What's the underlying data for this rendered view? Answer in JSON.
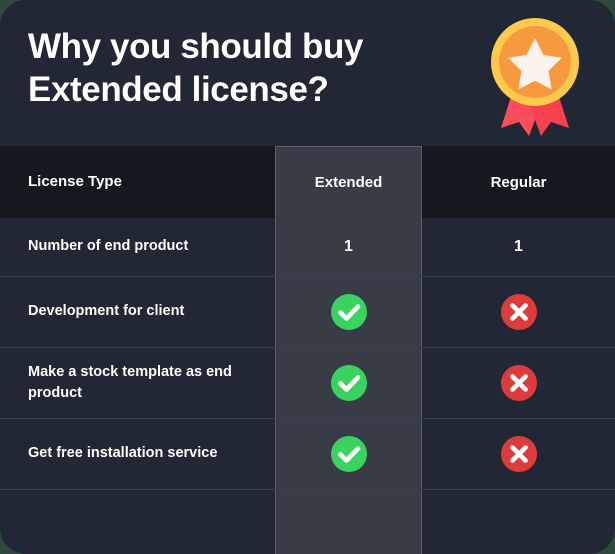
{
  "hero": {
    "title": "Why you should buy Extended license?",
    "badge_icon": "award-ribbon-icon"
  },
  "colors": {
    "page_background": "#2f4a3d",
    "card_background": "#212734",
    "header_row_background": "#14181f",
    "highlight_column_background": "#373c47",
    "divider": "#39404f",
    "text": "#ffffff",
    "check_green": "#3ad35f",
    "cross_red": "#dc3c3c",
    "badge_gold": "#ffc94d",
    "badge_orange": "#f79a3e",
    "badge_ribbon_red": "#fc4d5a"
  },
  "table": {
    "columns": [
      {
        "key": "label",
        "label": "License Type"
      },
      {
        "key": "extended",
        "label": "Extended",
        "highlighted": true
      },
      {
        "key": "regular",
        "label": "Regular",
        "highlighted": false
      }
    ],
    "rows": [
      {
        "label": "Number of  end product",
        "extended": {
          "type": "text",
          "value": "1"
        },
        "regular": {
          "type": "text",
          "value": "1"
        }
      },
      {
        "label": "Development for client",
        "extended": {
          "type": "icon",
          "value": "check-circle-icon"
        },
        "regular": {
          "type": "icon",
          "value": "cross-circle-icon"
        }
      },
      {
        "label": "Make a stock template as end product",
        "extended": {
          "type": "icon",
          "value": "check-circle-icon"
        },
        "regular": {
          "type": "icon",
          "value": "cross-circle-icon"
        }
      },
      {
        "label": "Get free installation service",
        "extended": {
          "type": "icon",
          "value": "check-circle-icon"
        },
        "regular": {
          "type": "icon",
          "value": "cross-circle-icon"
        }
      },
      {
        "label": "",
        "extended": {
          "type": "empty",
          "value": ""
        },
        "regular": {
          "type": "empty",
          "value": ""
        }
      }
    ]
  }
}
